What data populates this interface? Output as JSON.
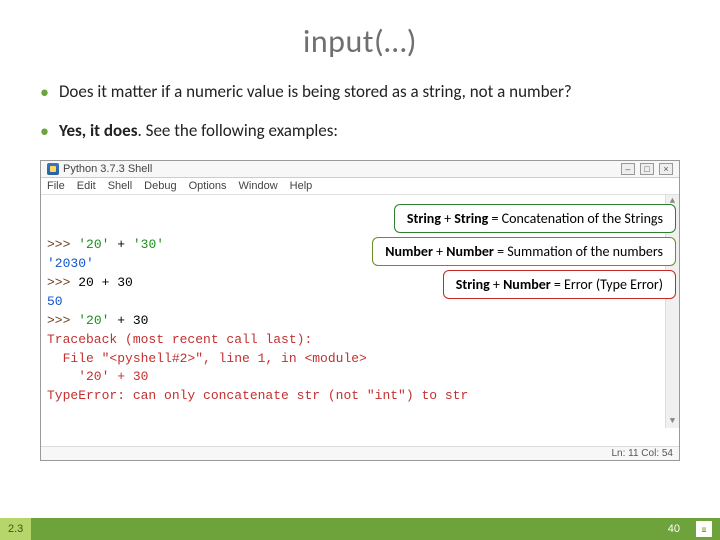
{
  "title": "input(…)",
  "bullets": [
    {
      "html": "Does it matter if a numeric value is being stored as a string, not a number?"
    },
    {
      "html": "<b>Yes, it does</b>. See the following examples:"
    }
  ],
  "shell": {
    "window_title": "Python 3.7.3 Shell",
    "menu": [
      "File",
      "Edit",
      "Shell",
      "Debug",
      "Options",
      "Window",
      "Help"
    ],
    "lines": [
      {
        "parts": [
          {
            "cls": "prompt",
            "t": ">>> "
          },
          {
            "cls": "pystr",
            "t": "'20'"
          },
          {
            "cls": "",
            "t": " + "
          },
          {
            "cls": "pystr",
            "t": "'30'"
          }
        ]
      },
      {
        "parts": [
          {
            "cls": "pyout",
            "t": "'2030'"
          }
        ]
      },
      {
        "parts": [
          {
            "cls": "prompt",
            "t": ">>> "
          },
          {
            "cls": "",
            "t": "20 + 30"
          }
        ]
      },
      {
        "parts": [
          {
            "cls": "pynum",
            "t": "50"
          }
        ]
      },
      {
        "parts": [
          {
            "cls": "prompt",
            "t": ">>> "
          },
          {
            "cls": "pystr",
            "t": "'20'"
          },
          {
            "cls": "",
            "t": " + 30"
          }
        ]
      },
      {
        "parts": [
          {
            "cls": "pyerr",
            "t": "Traceback (most recent call last):"
          }
        ]
      },
      {
        "parts": [
          {
            "cls": "pyerr",
            "t": "  File \"<pyshell#2>\", line 1, in <module>"
          }
        ]
      },
      {
        "parts": [
          {
            "cls": "pyerr",
            "t": "    '20' + 30"
          }
        ]
      },
      {
        "parts": [
          {
            "cls": "pyerr",
            "t": "TypeError: can only concatenate str (not \"int\") to str"
          }
        ]
      }
    ],
    "status": "Ln: 11  Col: 54"
  },
  "callouts": {
    "green": {
      "html": "<b>String</b> + <b>String</b> = Concatenation of the Strings"
    },
    "olive": {
      "html": "<b>Number</b> + <b>Number</b> = Summation of the numbers"
    },
    "red": {
      "html": "<b>String</b> + <b>Number</b> = Error (Type Error)"
    }
  },
  "footer": {
    "section": "2.3",
    "page": "40"
  }
}
